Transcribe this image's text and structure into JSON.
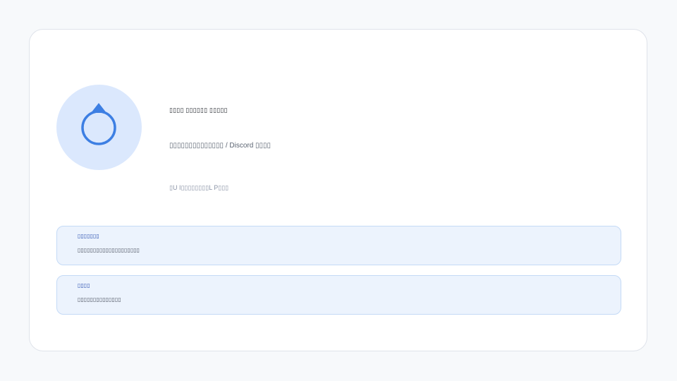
{
  "header": {
    "title": "▯▯▯▯ ▯▯▯▯▯▯ ▯▯▯▯▯",
    "subtitle": "▯▯▯▯▯▯▯▯▯▯▯▯▯▯ / Discord ▯▯▯▯",
    "meta": "▯U I▯▯▯▯▯▯▯▯L P▯▯▯"
  },
  "icon": {
    "name": "ring-icon",
    "color": "#3d7fe3",
    "background": "#dbe8fd"
  },
  "boxes": [
    {
      "title": "▯▯▯▯▯▯▯",
      "text": "▯▯▯▯▯▯▯▯▯▯▯▯▯▯▯▯▯▯▯▯"
    },
    {
      "title": "▯▯▯▯",
      "text": "▯▯▯▯▯▯▯▯▯▯▯▯▯▯"
    }
  ],
  "colors": {
    "accent": "#3d7fe3",
    "box_background": "#ecf3fd",
    "box_border": "#c4daf6"
  }
}
